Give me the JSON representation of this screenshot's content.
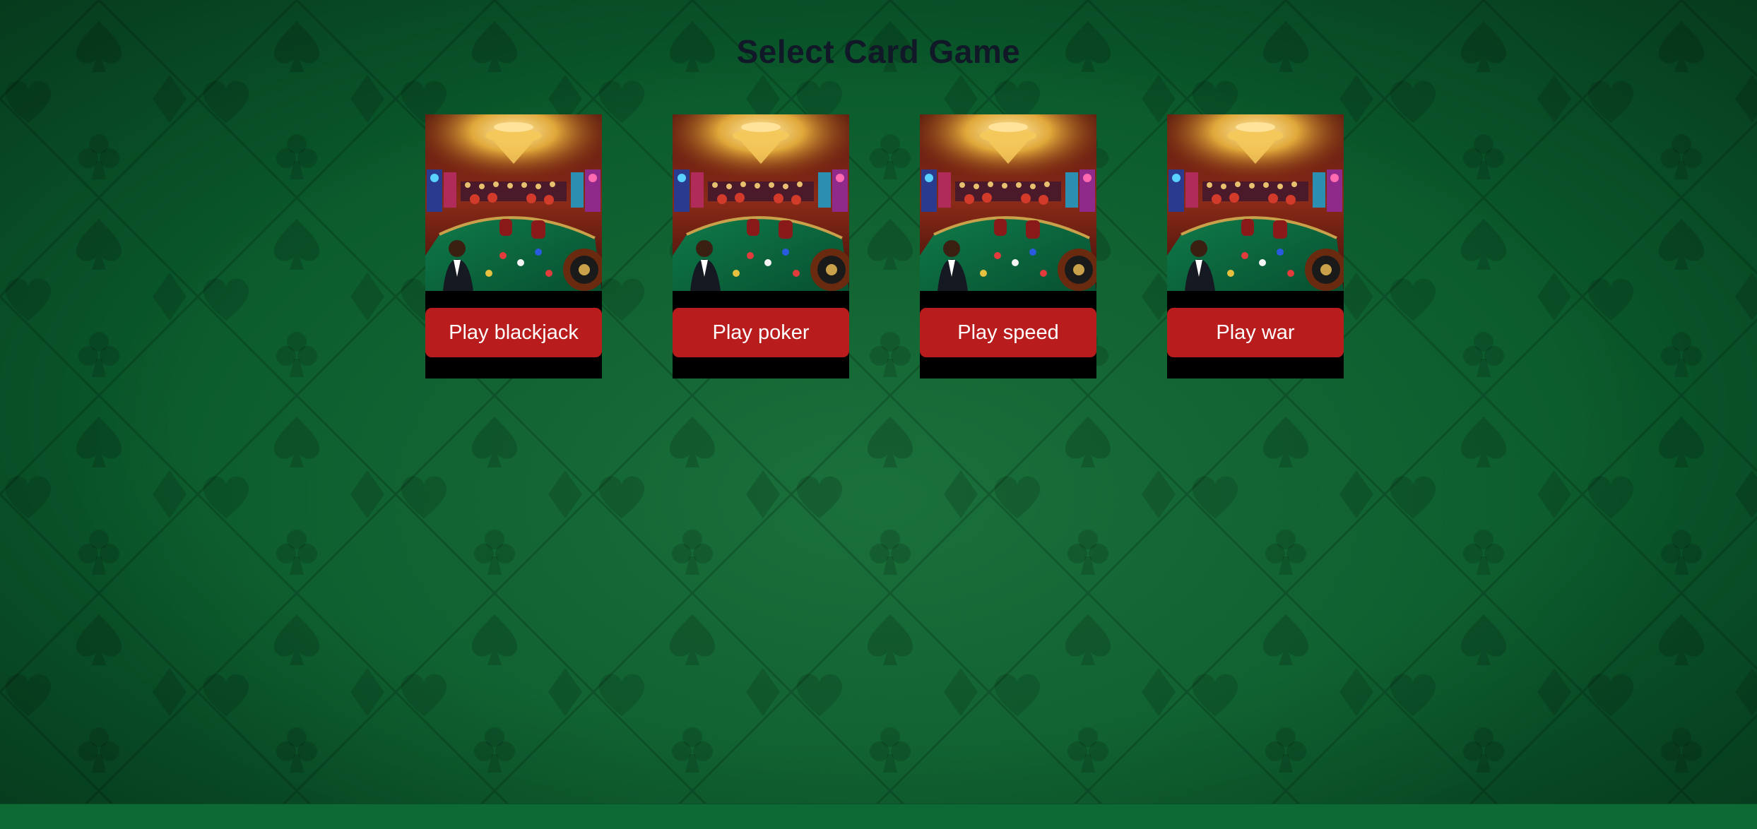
{
  "page": {
    "title": "Select Card Game"
  },
  "theme": {
    "felt_color": "#0a5a2c",
    "button_color": "#b91c1c",
    "title_color": "#111827"
  },
  "games": [
    {
      "id": "blackjack",
      "button_label": "Play blackjack",
      "image": "casino-scene-image"
    },
    {
      "id": "poker",
      "button_label": "Play poker",
      "image": "casino-scene-image"
    },
    {
      "id": "speed",
      "button_label": "Play speed",
      "image": "casino-scene-image"
    },
    {
      "id": "war",
      "button_label": "Play war",
      "image": "casino-scene-image"
    }
  ]
}
